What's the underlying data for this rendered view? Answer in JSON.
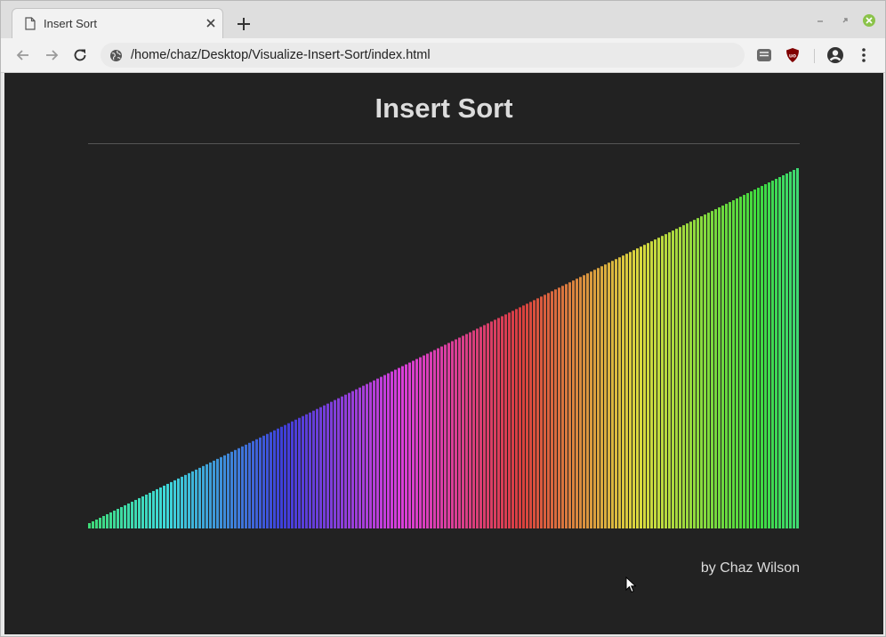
{
  "browser": {
    "tab": {
      "title": "Insert Sort"
    },
    "address_bar": {
      "url": "/home/chaz/Desktop/Visualize-Insert-Sort/index.html"
    }
  },
  "page": {
    "title": "Insert Sort",
    "byline": "by Chaz Wilson"
  },
  "chart_data": {
    "type": "bar",
    "count": 200,
    "values": "ascending 1..200 (sorted)",
    "color_scheme": "rainbow hue by value (green → teal → blue → purple → red → orange → yellow → green)",
    "ylim": [
      0,
      200
    ]
  }
}
